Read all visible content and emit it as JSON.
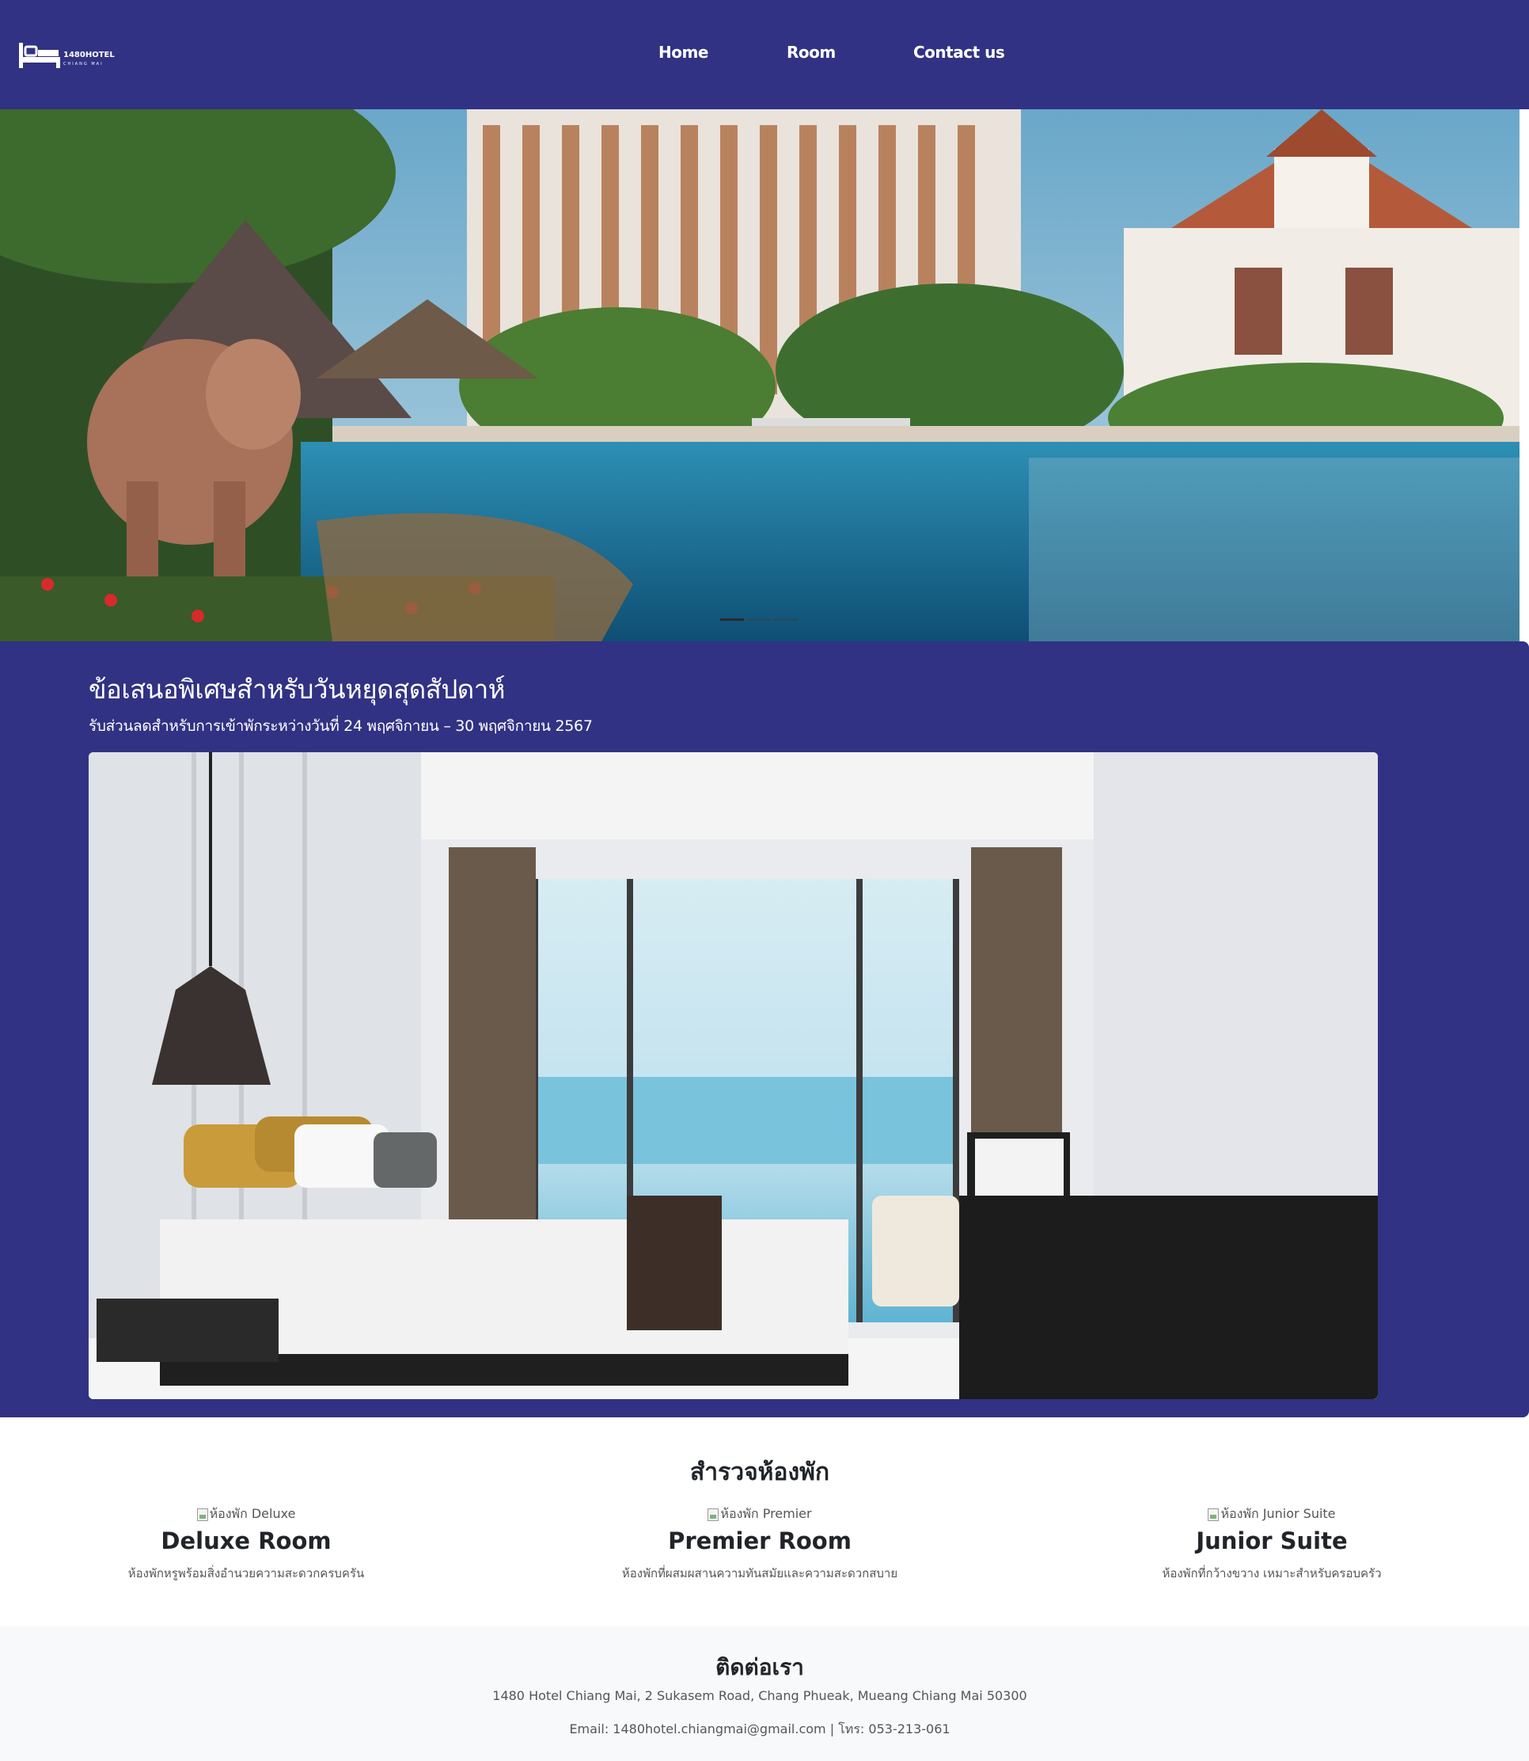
{
  "navbar": {
    "logo_text": "1480HOTEL",
    "logo_sub": "CHIANG MAI",
    "links": [
      {
        "label": "Home"
      },
      {
        "label": "Room"
      },
      {
        "label": "Contact us"
      }
    ],
    "bg_color": "#313283"
  },
  "hero": {
    "carousel_indicators": 3,
    "active_indicator": 1
  },
  "promo": {
    "title": "ข้อเสนอพิเศษสำหรับวันหยุดสุดสัปดาห์",
    "subtitle": "รับส่วนลดสำหรับการเข้าพักระหว่างวันที่ 24 พฤศจิกายน – 30 พฤศจิกายน 2567"
  },
  "rooms": {
    "title": "สำรวจห้องพัก",
    "items": [
      {
        "alt": "ห้องพัก Deluxe",
        "name": "Deluxe Room",
        "desc": "ห้องพักหรูพร้อมสิ่งอำนวยความสะดวกครบครัน"
      },
      {
        "alt": "ห้องพัก Premier",
        "name": "Premier Room",
        "desc": "ห้องพักที่ผสมผสานความทันสมัยและความสะดวกสบาย"
      },
      {
        "alt": "ห้องพัก Junior Suite",
        "name": "Junior Suite",
        "desc": "ห้องพักที่กว้างขวาง เหมาะสำหรับครอบครัว"
      }
    ]
  },
  "footer": {
    "title": "ติดต่อเรา",
    "address": "1480 Hotel Chiang Mai, 2 Sukasem Road, Chang Phueak, Mueang Chiang Mai 50300",
    "contact": "Email: 1480hotel.chiangmai@gmail.com | โทร: 053-213-061"
  }
}
